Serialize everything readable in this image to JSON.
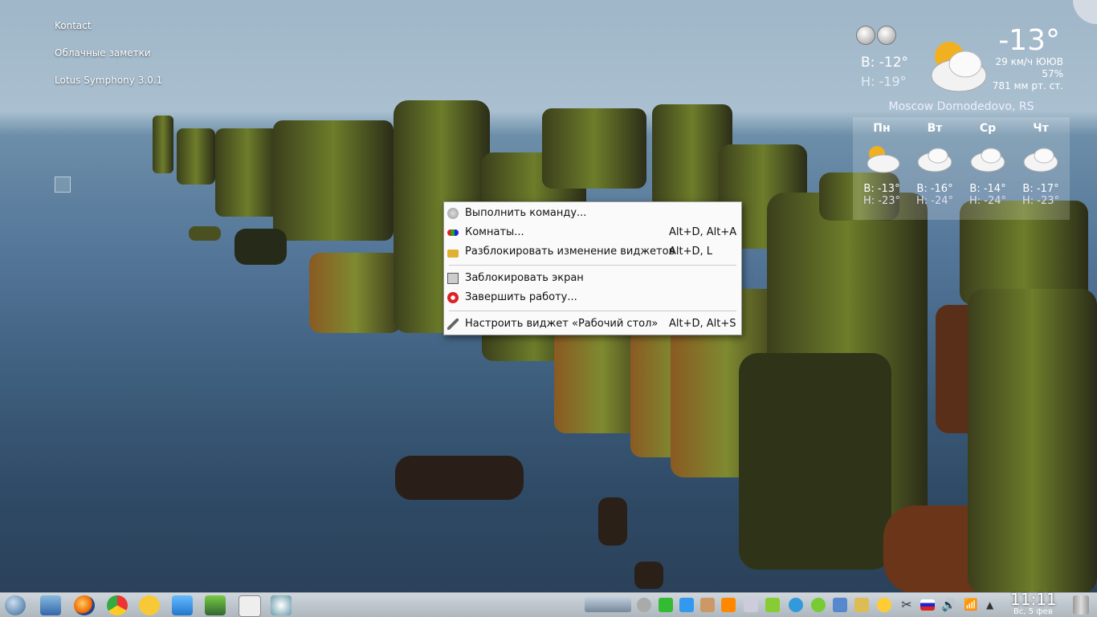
{
  "desktop": {
    "links": [
      "Kontact",
      "Облачные заметки",
      "Lotus Symphony 3.0.1"
    ]
  },
  "weather": {
    "current_temp": "-13°",
    "high": "В: -12°",
    "low": "Н: -19°",
    "wind": "29 км/ч ЮЮВ",
    "humidity": "57%",
    "pressure": "781 мм рт. ст.",
    "station": "Moscow Domodedovo, RS",
    "days": [
      {
        "name": "Пн",
        "high": "В: -13°",
        "low": "Н: -23°"
      },
      {
        "name": "Вт",
        "high": "В: -16°",
        "low": "Н: -24°"
      },
      {
        "name": "Ср",
        "high": "В: -14°",
        "low": "Н: -24°"
      },
      {
        "name": "Чт",
        "high": "В: -17°",
        "low": "Н: -23°"
      }
    ]
  },
  "menu": {
    "items": [
      {
        "label": "Выполнить команду...",
        "shortcut": "",
        "icon": "run-command-icon"
      },
      {
        "label": "Комнаты...",
        "shortcut": "Alt+D, Alt+A",
        "icon": "activities-icon"
      },
      {
        "label": "Разблокировать изменение виджетов",
        "shortcut": "Alt+D, L",
        "icon": "unlock-icon"
      },
      {
        "label": "Заблокировать экран",
        "shortcut": "",
        "icon": "lock-screen-icon"
      },
      {
        "label": "Завершить работу...",
        "shortcut": "",
        "icon": "shutdown-icon"
      },
      {
        "label": "Настроить виджет «Рабочий стол»",
        "shortcut": "Alt+D, Alt+S",
        "icon": "configure-icon"
      }
    ]
  },
  "taskbar": {
    "time": "11:11",
    "date": "Вс, 5 фев"
  }
}
